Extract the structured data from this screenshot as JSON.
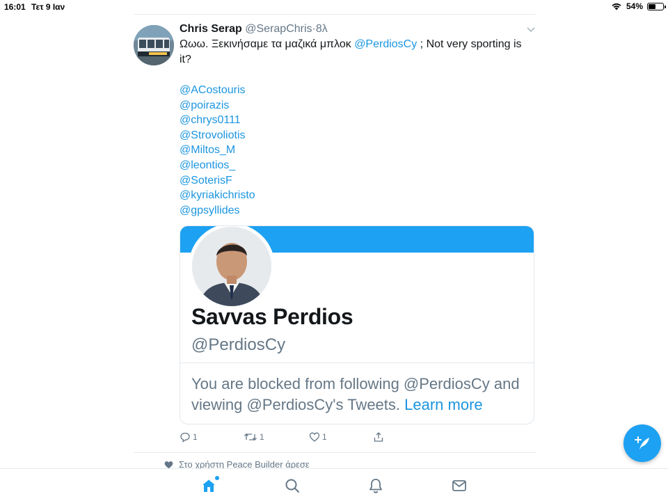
{
  "status_bar": {
    "time": "16:01",
    "date": "Τετ 9 Ιαν",
    "battery": "54%",
    "battery_level": 0.54
  },
  "tweet": {
    "author_name": "Chris Serap",
    "author_handle": "@SerapChris",
    "separator": "·",
    "age": "8λ",
    "text_before": "Ωωω. Ξεκινήσαμε τα μαζικά μπλοκ ",
    "text_mention": "@PerdiosCy",
    "text_after": " ; Not very sporting is it?",
    "mentions": [
      "@ACostouris",
      "@poirazis",
      "@chrys0111",
      "@Strovoliotis",
      "@Miltos_M",
      "@leontios_",
      "@SoterisF",
      "@kyriakichristo",
      "@gpsyllides"
    ],
    "card": {
      "name": "Savvas Perdios",
      "handle": "@PerdiosCy",
      "message": "You are blocked from following @PerdiosCy and viewing @PerdiosCy's Tweets. ",
      "learn_more": "Learn more"
    },
    "actions": {
      "replies": "1",
      "retweets": "1",
      "likes": "1"
    }
  },
  "liked_notice": "Στο χρήστη Peace  Builder άρεσε",
  "icons": {
    "wifi": "wifi-icon",
    "battery": "battery-icon",
    "caret": "chevron-down-icon",
    "reply": "reply-icon",
    "retweet": "retweet-icon",
    "like": "heart-icon",
    "share": "share-icon",
    "home": "home-icon",
    "search": "search-icon",
    "notifications": "bell-icon",
    "messages": "mail-icon",
    "compose": "compose-icon"
  },
  "colors": {
    "accent": "#1da1f2",
    "link": "#1b95e0",
    "muted": "#657786",
    "text": "#14171a"
  }
}
